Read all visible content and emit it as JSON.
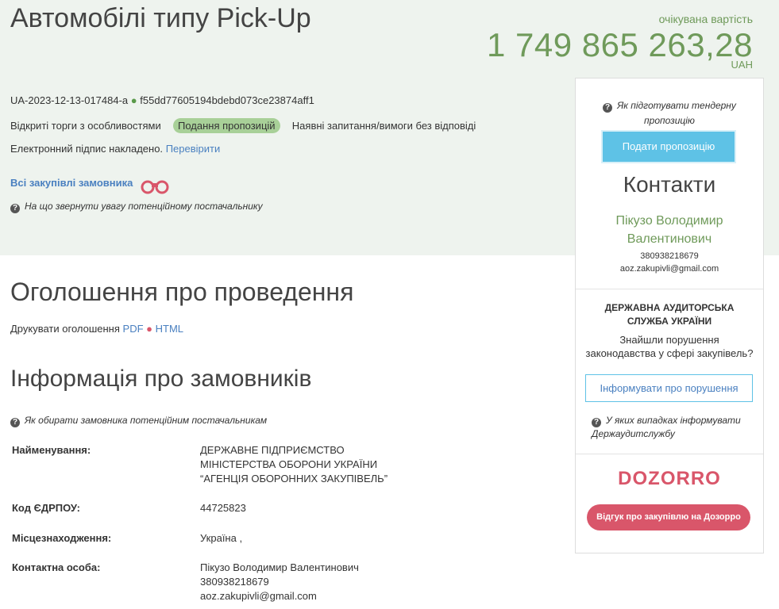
{
  "tender": {
    "title": "Автомобілі типу Pick-Up",
    "estimated_label": "очікувана вартість",
    "estimated_value": "1 749 865 263,28",
    "currency": "UAH",
    "tender_id": "UA-2023-12-13-017484-a",
    "tender_hash": "f55dd77605194bdebd073ce23874aff1",
    "procedure": "Відкриті торги з особливостями",
    "status_badge": "Подання пропозицій",
    "questions_status": "Наявні запитання/вимоги без відповіді",
    "signature_text": "Електронний підпис накладено.",
    "verify_link": "Перевірити",
    "all_purchases_link": "Всі закупівлі замовника",
    "attention_hint": "На що звернути увагу потенційному постачальнику"
  },
  "announcement": {
    "title": "Оголошення про проведення",
    "print_label": "Друкувати оголошення",
    "pdf_link": "PDF",
    "html_link": "HTML"
  },
  "customer": {
    "title": "Інформація про замовників",
    "hint": "Як обирати замовника потенційним постачальникам",
    "rows": [
      {
        "label": "Найменування:",
        "value": "ДЕРЖАВНЕ ПІДПРИЄМСТВО МІНІСТЕРСТВА ОБОРОНИ УКРАЇНИ “АГЕНЦІЯ ОБОРОННИХ ЗАКУПІВЕЛЬ”"
      },
      {
        "label": "Код ЄДРПОУ:",
        "value": "44725823"
      },
      {
        "label": "Місцезнаходження:",
        "value": "Україна ,"
      },
      {
        "label": "Контактна особа:",
        "value": "Пікузо Володимир Валентинович",
        "phone": "380938218679",
        "email": "aoz.zakupivli@gmail.com"
      }
    ]
  },
  "sidebar": {
    "prepare_hint": "Як підготувати тендерну пропозицію",
    "submit_button": "Подати пропозицію",
    "contacts_title": "Контакти",
    "contact_name": "Пікузо Володимир Валентинович",
    "contact_phone": "380938218679",
    "contact_email": "aoz.zakupivli@gmail.com",
    "dasu_title": "ДЕРЖАВНА АУДИТОРСЬКА СЛУЖБА УКРАЇНИ",
    "dasu_question": "Знайшли порушення законодавства у сфері закупівель?",
    "report_button": "Інформувати про порушення",
    "dasu_hint": "У яких випадках інформувати Держаудитслужбу",
    "dozorro_logo": "DOZORRO",
    "dozorro_button": "Відгук про закупівлю на Дозорро"
  },
  "colors": {
    "accent_green": "#6f9a5a",
    "badge_green": "#a8d098",
    "link_blue": "#4a80c0",
    "button_cyan": "#5ec2e6",
    "dozorro_red": "#d9566a",
    "hero_bg": "#eef3ee"
  },
  "icons": [
    "question-icon",
    "binoculars-icon"
  ]
}
